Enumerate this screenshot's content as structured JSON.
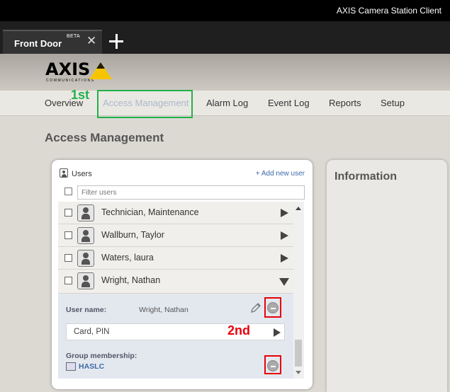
{
  "app": {
    "title": "AXIS Camera Station Client"
  },
  "tabs": [
    {
      "label": "Front Door",
      "badge": "BETA"
    }
  ],
  "logo": {
    "text": "AXIS",
    "subtitle": "COMMUNICATIONS"
  },
  "nav": {
    "items": [
      {
        "label": "Overview"
      },
      {
        "label": "Access Management",
        "active": true
      },
      {
        "label": "Alarm Log"
      },
      {
        "label": "Event Log"
      },
      {
        "label": "Reports"
      },
      {
        "label": "Setup"
      }
    ]
  },
  "page": {
    "title": "Access Management"
  },
  "annotations": {
    "first": "1st",
    "second": "2nd"
  },
  "users_panel": {
    "title": "Users",
    "add_label": "+ Add new user",
    "filter_placeholder": "Filter users",
    "users": [
      {
        "name": "Technician, Maintenance"
      },
      {
        "name": "Wallburn, Taylor"
      },
      {
        "name": "Waters, laura"
      },
      {
        "name": "Wright, Nathan",
        "expanded": true
      }
    ],
    "detail": {
      "username_label": "User name:",
      "username_value": "Wright, Nathan",
      "credential": "Card, PIN",
      "group_label": "Group membership:",
      "group_name": "HASLC"
    }
  },
  "info_panel": {
    "title": "Information"
  },
  "colors": {
    "highlight_green": "#22b14c",
    "highlight_red": "#e8000b",
    "link_blue": "#3d6aa8"
  }
}
